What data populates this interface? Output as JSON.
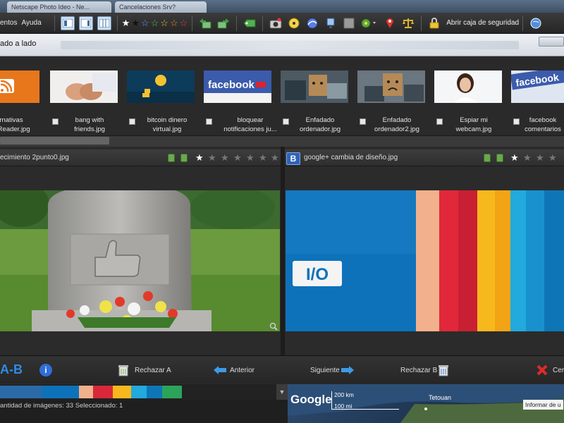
{
  "browser_tabs": [
    "Netscape Photo Ideo - Ne...",
    "Cancelaciones Srv?"
  ],
  "menu": {
    "item1": "entos",
    "item2": "Ayuda"
  },
  "toolbar": {
    "lock_label": "Abrir caja de seguridad"
  },
  "address": {
    "title": "ado a lado"
  },
  "thumbnails": [
    {
      "caption": "ternativas\ngle Reader.jpg"
    },
    {
      "caption": "bang with\nfriends.jpg"
    },
    {
      "caption": "bitcoin dinero\nvirtual.jpg"
    },
    {
      "caption": "bloquear\nnotificaciones ju..."
    },
    {
      "caption": "Enfadado\nordenador.jpg"
    },
    {
      "caption": "Enfadado\nordenador2.jpg"
    },
    {
      "caption": "Espiar mi\nwebcam.jpg"
    },
    {
      "caption": "facebook\ncomentarios"
    }
  ],
  "viewer_a": {
    "title": "ecimiento 2punto0.jpg"
  },
  "viewer_b": {
    "title": "google+ cambia de diseño.jpg",
    "badge": "B"
  },
  "nav": {
    "ab_label": "A-B",
    "reject_a": "Rechazar A",
    "previous": "Anterior",
    "next": "Siguiente",
    "reject_b": "Rechazar B",
    "close": "Cer"
  },
  "status": {
    "text": "antidad de imágenes: 33 Seleccionado: 1"
  },
  "map": {
    "logo": "Google",
    "scale_km": "200 km",
    "scale_mi": "100 mi",
    "city": "Tetouan",
    "report": "Informar de u"
  },
  "thumb_texts": {
    "facebook": "facebook"
  },
  "io_text": "I/O",
  "colors": {
    "accent": "#2f7fd3",
    "dark": "#2b2b2b"
  }
}
